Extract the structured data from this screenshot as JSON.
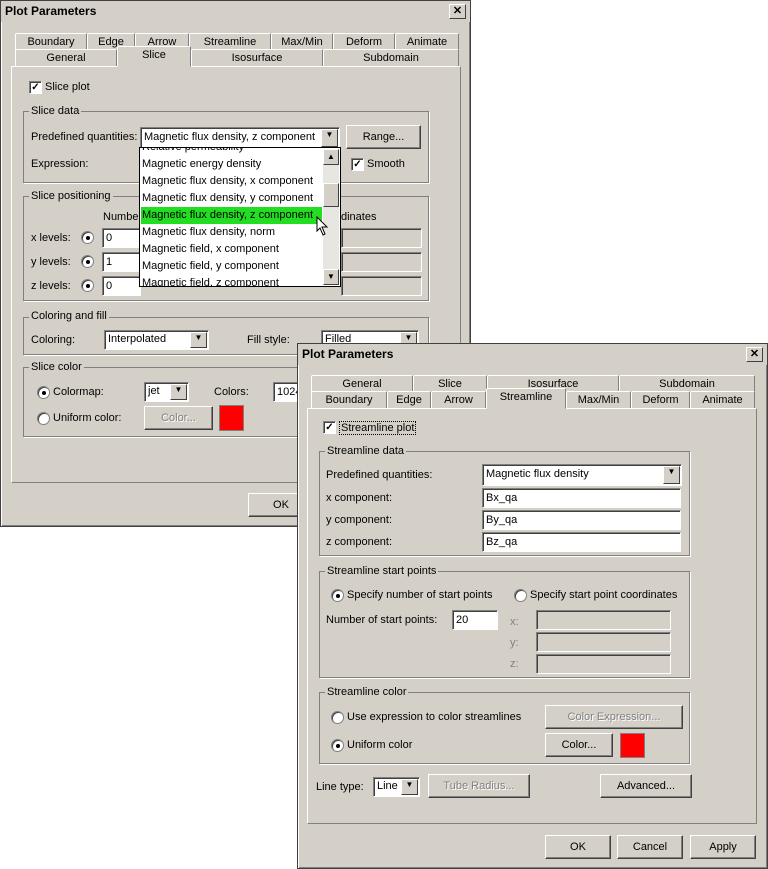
{
  "back": {
    "title": "Plot Parameters",
    "close": "✕",
    "tabs_row1": [
      "Boundary",
      "Edge",
      "Arrow",
      "Streamline",
      "Max/Min",
      "Deform",
      "Animate"
    ],
    "tabs_row2": [
      "General",
      "Slice",
      "Isosurface",
      "Subdomain"
    ],
    "slice_plot": "Slice plot",
    "slice_data": {
      "label": "Slice data",
      "predefined_label": "Predefined quantities:",
      "predefined_value": "Magnetic flux density, z component",
      "range_button": "Range...",
      "expression_label": "Expression:",
      "smooth_label": "Smooth"
    },
    "dropdown": {
      "items": [
        "Relative permeability",
        "Magnetic energy density",
        "Magnetic flux density, x component",
        "Magnetic flux density, y component",
        "Magnetic flux density, z component",
        "Magnetic flux density, norm",
        "Magnetic field, x component",
        "Magnetic field, y component",
        "Magnetic field, z component"
      ]
    },
    "slice_positioning": {
      "label": "Slice positioning",
      "number_col": "Number",
      "coords_col": "dinates",
      "x_label": "x levels:",
      "y_label": "y levels:",
      "z_label": "z levels:",
      "x_value": "0",
      "y_value": "1",
      "z_value": "0"
    },
    "coloring": {
      "label": "Coloring and fill",
      "coloring_label": "Coloring:",
      "coloring_value": "Interpolated",
      "fill_label": "Fill style:",
      "fill_value": "Filled"
    },
    "slice_color": {
      "label": "Slice color",
      "colormap_label": "Colormap:",
      "colormap_value": "jet",
      "colors_label": "Colors:",
      "colors_value": "1024",
      "uniform_label": "Uniform color:",
      "color_button": "Color...",
      "swatch": "#ff0000"
    },
    "ok": "OK"
  },
  "front": {
    "title": "Plot Parameters",
    "close": "✕",
    "tabs_row1": [
      "General",
      "Slice",
      "Isosurface",
      "Subdomain"
    ],
    "tabs_row2": [
      "Boundary",
      "Edge",
      "Arrow",
      "Streamline",
      "Max/Min",
      "Deform",
      "Animate"
    ],
    "streamline_plot": "Streamline plot",
    "streamline_data": {
      "label": "Streamline data",
      "predefined_label": "Predefined quantities:",
      "predefined_value": "Magnetic flux density",
      "x_label": "x component:",
      "x_value": "Bx_qa",
      "y_label": "y component:",
      "y_value": "By_qa",
      "z_label": "z component:",
      "z_value": "Bz_qa"
    },
    "start_points": {
      "label": "Streamline start points",
      "opt_number": "Specify number of start points",
      "opt_coords": "Specify start point coordinates",
      "number_label": "Number of start points:",
      "number_value": "20",
      "x": "x:",
      "y": "y:",
      "z": "z:"
    },
    "streamline_color": {
      "label": "Streamline color",
      "opt_expr": "Use expression to color streamlines",
      "expr_button": "Color Expression...",
      "opt_uniform": "Uniform color",
      "color_button": "Color...",
      "swatch": "#ff0000"
    },
    "line_type_label": "Line type:",
    "line_type_value": "Line",
    "tube_button": "Tube Radius...",
    "advanced_button": "Advanced...",
    "ok": "OK",
    "cancel": "Cancel",
    "apply": "Apply"
  }
}
